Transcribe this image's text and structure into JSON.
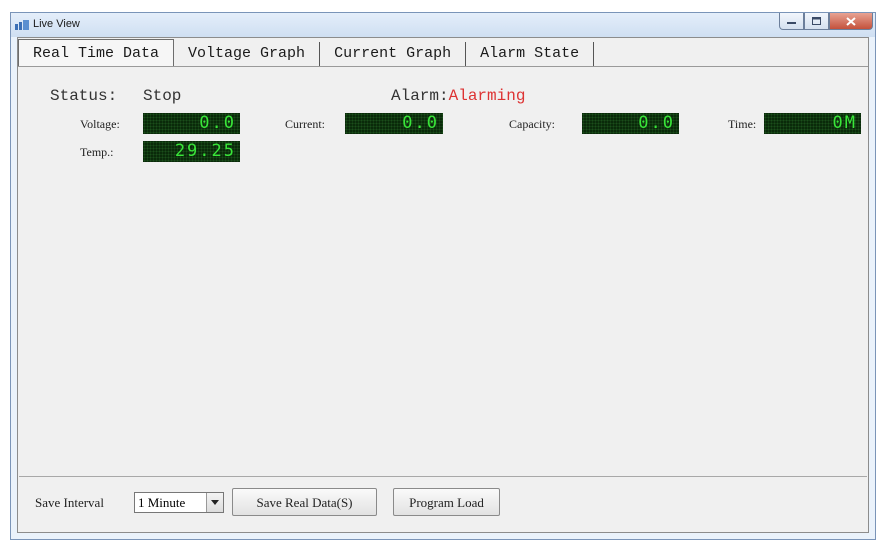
{
  "window": {
    "title": "Live View"
  },
  "tabs": [
    {
      "label": "Real Time Data",
      "active": true
    },
    {
      "label": "Voltage Graph"
    },
    {
      "label": "Current Graph"
    },
    {
      "label": "Alarm State"
    }
  ],
  "status": {
    "label": "Status:",
    "value": "Stop"
  },
  "alarm": {
    "label": "Alarm:",
    "value": "Alarming"
  },
  "readings": {
    "voltage": {
      "label": "Voltage:",
      "value": "0.0"
    },
    "current": {
      "label": "Current:",
      "value": "0.0"
    },
    "capacity": {
      "label": "Capacity:",
      "value": "0.0"
    },
    "time": {
      "label": "Time:",
      "value": "0M"
    },
    "temp": {
      "label": "Temp.:",
      "value": "29.25"
    }
  },
  "bottom": {
    "save_interval_label": "Save Interval",
    "save_interval_value": "1 Minute",
    "save_button": "Save Real Data(S)",
    "program_button": "Program Load"
  },
  "colors": {
    "lcd_text": "#39e639",
    "lcd_bg": "#0a2a0a",
    "alarm": "#d33333"
  }
}
